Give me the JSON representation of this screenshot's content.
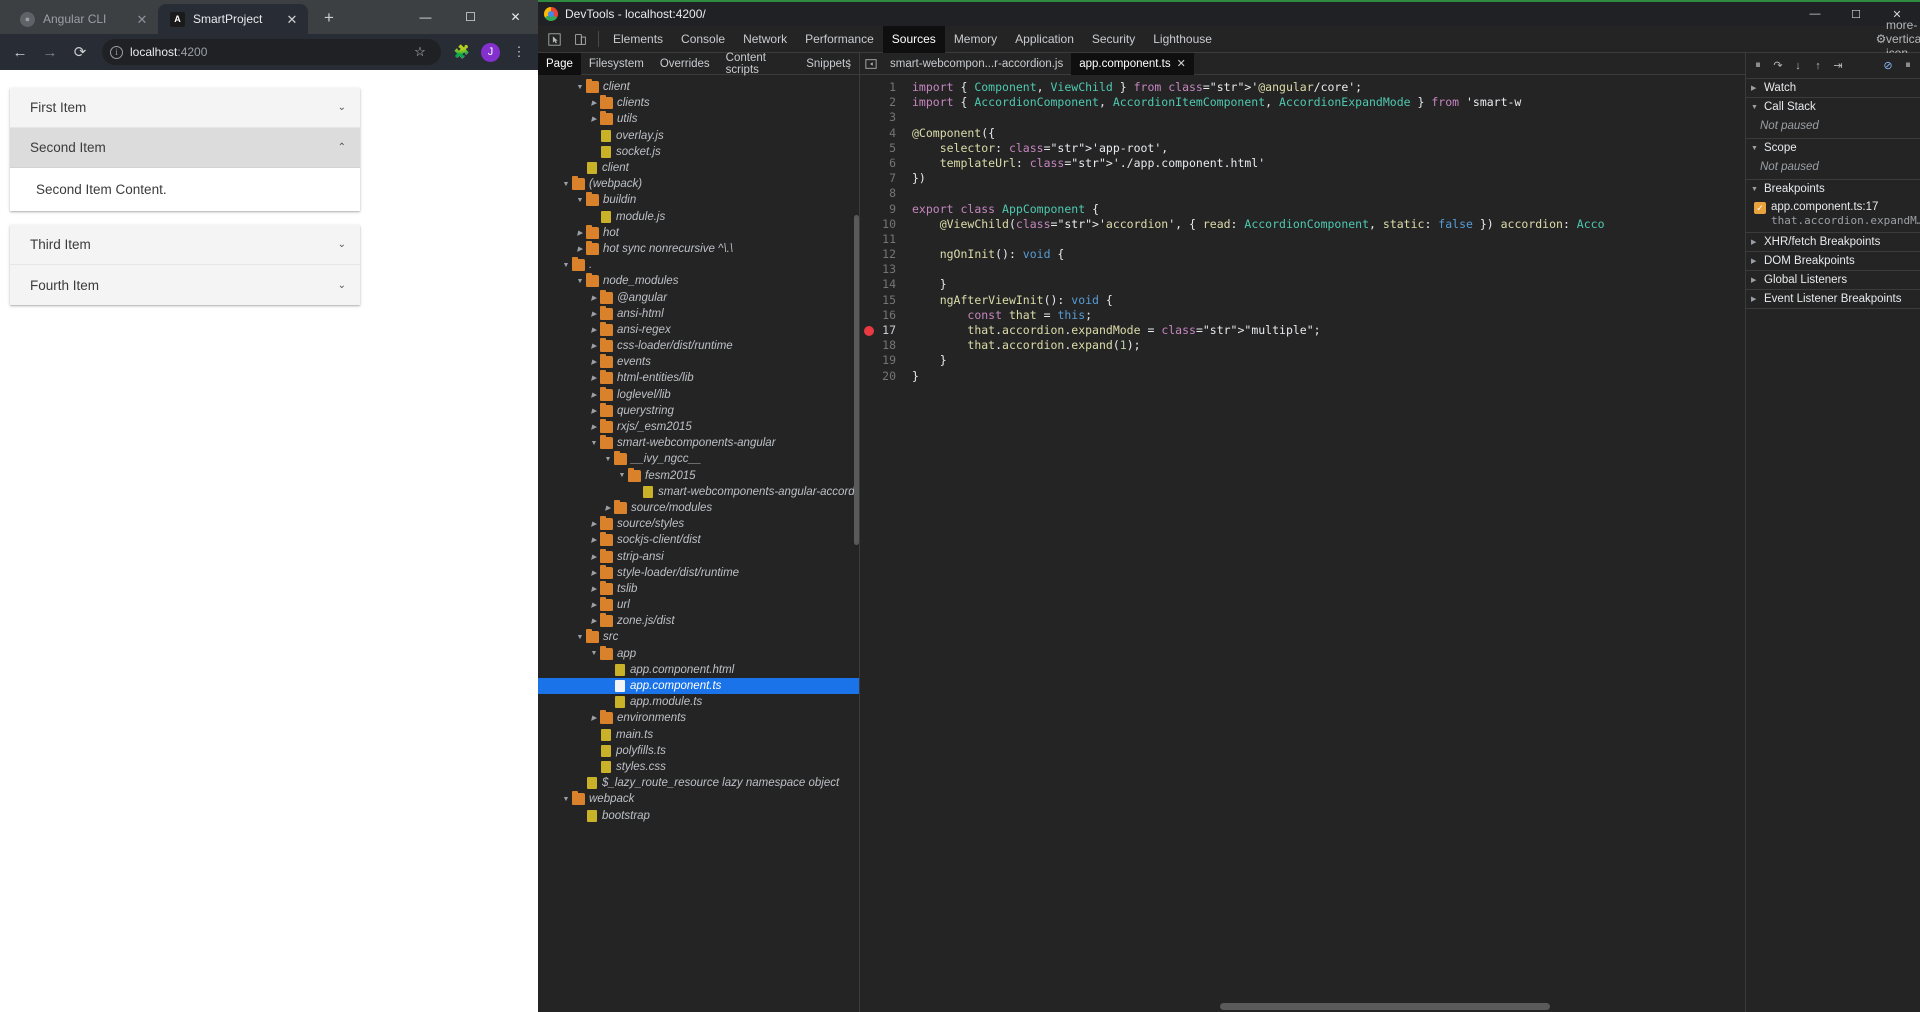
{
  "browser": {
    "tabs": [
      {
        "title": "Angular CLI",
        "favicon": "angular-grey-icon",
        "active": false,
        "close": "✕"
      },
      {
        "title": "SmartProject",
        "favicon": "angular-icon",
        "active": true,
        "close": "✕"
      }
    ],
    "new_tab_label": "+",
    "window_controls": {
      "minimize": "—",
      "maximize": "☐",
      "close": "✕"
    },
    "toolbar": {
      "back": "←",
      "forward": "→",
      "reload": "⟳",
      "url_host": "localhost",
      "url_port": ":4200",
      "star": "☆",
      "extensions": "🧩",
      "avatar_letter": "J",
      "menu": "⋮"
    }
  },
  "accordion": {
    "items": [
      {
        "label": "First Item",
        "expanded": false,
        "selected": false,
        "chevron": "⌄",
        "content": ""
      },
      {
        "label": "Second Item",
        "expanded": true,
        "selected": true,
        "chevron": "⌃",
        "content": "Second Item Content."
      },
      {
        "label": "Third Item",
        "expanded": false,
        "selected": false,
        "chevron": "⌄",
        "content": ""
      },
      {
        "label": "Fourth Item",
        "expanded": false,
        "selected": false,
        "chevron": "⌄",
        "content": ""
      }
    ]
  },
  "devtools": {
    "window_title": "DevTools - localhost:4200/",
    "window_controls": {
      "minimize": "—",
      "maximize": "☐",
      "close": "✕"
    },
    "main_tabs": [
      {
        "label": "Elements",
        "active": false
      },
      {
        "label": "Console",
        "active": false
      },
      {
        "label": "Network",
        "active": false
      },
      {
        "label": "Performance",
        "active": false
      },
      {
        "label": "Sources",
        "active": true
      },
      {
        "label": "Memory",
        "active": false
      },
      {
        "label": "Application",
        "active": false
      },
      {
        "label": "Security",
        "active": false
      },
      {
        "label": "Lighthouse",
        "active": false
      }
    ],
    "inspect_icon": "cursor-inspect-icon",
    "device_icon": "device-toolbar-icon",
    "settings_icon": "gear-icon",
    "more_icon": "more-vertical-icon",
    "navigator": {
      "tabs": [
        {
          "label": "Page",
          "active": true
        },
        {
          "label": "Filesystem",
          "active": false
        },
        {
          "label": "Overrides",
          "active": false
        },
        {
          "label": "Content scripts",
          "active": false
        },
        {
          "label": "Snippets",
          "active": false
        }
      ],
      "more": "⋮",
      "tree": [
        {
          "label": "client",
          "depth": 2,
          "type": "folder",
          "twisty": "▼"
        },
        {
          "label": "clients",
          "depth": 3,
          "type": "folder",
          "twisty": "▶"
        },
        {
          "label": "utils",
          "depth": 3,
          "type": "folder",
          "twisty": "▶"
        },
        {
          "label": "overlay.js",
          "depth": 3,
          "type": "file",
          "twisty": ""
        },
        {
          "label": "socket.js",
          "depth": 3,
          "type": "file",
          "twisty": ""
        },
        {
          "label": "client",
          "depth": 2,
          "type": "file",
          "twisty": ""
        },
        {
          "label": "(webpack)",
          "depth": 1,
          "type": "folder",
          "twisty": "▼"
        },
        {
          "label": "buildin",
          "depth": 2,
          "type": "folder",
          "twisty": "▼"
        },
        {
          "label": "module.js",
          "depth": 3,
          "type": "file",
          "twisty": ""
        },
        {
          "label": "hot",
          "depth": 2,
          "type": "folder",
          "twisty": "▶"
        },
        {
          "label": "hot sync nonrecursive ^\\.\\",
          "depth": 2,
          "type": "folder",
          "twisty": "▶"
        },
        {
          "label": ".",
          "depth": 1,
          "type": "folder",
          "twisty": "▼"
        },
        {
          "label": "node_modules",
          "depth": 2,
          "type": "folder",
          "twisty": "▼"
        },
        {
          "label": "@angular",
          "depth": 3,
          "type": "folder",
          "twisty": "▶"
        },
        {
          "label": "ansi-html",
          "depth": 3,
          "type": "folder",
          "twisty": "▶"
        },
        {
          "label": "ansi-regex",
          "depth": 3,
          "type": "folder",
          "twisty": "▶"
        },
        {
          "label": "css-loader/dist/runtime",
          "depth": 3,
          "type": "folder",
          "twisty": "▶"
        },
        {
          "label": "events",
          "depth": 3,
          "type": "folder",
          "twisty": "▶"
        },
        {
          "label": "html-entities/lib",
          "depth": 3,
          "type": "folder",
          "twisty": "▶"
        },
        {
          "label": "loglevel/lib",
          "depth": 3,
          "type": "folder",
          "twisty": "▶"
        },
        {
          "label": "querystring",
          "depth": 3,
          "type": "folder",
          "twisty": "▶"
        },
        {
          "label": "rxjs/_esm2015",
          "depth": 3,
          "type": "folder",
          "twisty": "▶"
        },
        {
          "label": "smart-webcomponents-angular",
          "depth": 3,
          "type": "folder",
          "twisty": "▼"
        },
        {
          "label": "__ivy_ngcc__",
          "depth": 4,
          "type": "folder",
          "twisty": "▼"
        },
        {
          "label": "fesm2015",
          "depth": 5,
          "type": "folder",
          "twisty": "▼"
        },
        {
          "label": "smart-webcomponents-angular-accordion.js",
          "depth": 6,
          "type": "file",
          "twisty": ""
        },
        {
          "label": "source/modules",
          "depth": 4,
          "type": "folder",
          "twisty": "▶"
        },
        {
          "label": "source/styles",
          "depth": 3,
          "type": "folder",
          "twisty": "▶"
        },
        {
          "label": "sockjs-client/dist",
          "depth": 3,
          "type": "folder",
          "twisty": "▶"
        },
        {
          "label": "strip-ansi",
          "depth": 3,
          "type": "folder",
          "twisty": "▶"
        },
        {
          "label": "style-loader/dist/runtime",
          "depth": 3,
          "type": "folder",
          "twisty": "▶"
        },
        {
          "label": "tslib",
          "depth": 3,
          "type": "folder",
          "twisty": "▶"
        },
        {
          "label": "url",
          "depth": 3,
          "type": "folder",
          "twisty": "▶"
        },
        {
          "label": "zone.js/dist",
          "depth": 3,
          "type": "folder",
          "twisty": "▶"
        },
        {
          "label": "src",
          "depth": 2,
          "type": "folder",
          "twisty": "▼"
        },
        {
          "label": "app",
          "depth": 3,
          "type": "folder",
          "twisty": "▼"
        },
        {
          "label": "app.component.html",
          "depth": 4,
          "type": "file",
          "twisty": ""
        },
        {
          "label": "app.component.ts",
          "depth": 4,
          "type": "file",
          "twisty": "",
          "selected": true
        },
        {
          "label": "app.module.ts",
          "depth": 4,
          "type": "file",
          "twisty": ""
        },
        {
          "label": "environments",
          "depth": 3,
          "type": "folder",
          "twisty": "▶"
        },
        {
          "label": "main.ts",
          "depth": 3,
          "type": "file",
          "twisty": ""
        },
        {
          "label": "polyfills.ts",
          "depth": 3,
          "type": "file",
          "twisty": ""
        },
        {
          "label": "styles.css",
          "depth": 3,
          "type": "file",
          "twisty": ""
        },
        {
          "label": "$_lazy_route_resource lazy namespace object",
          "depth": 2,
          "type": "file",
          "twisty": ""
        },
        {
          "label": "webpack",
          "depth": 1,
          "type": "folder",
          "twisty": "▼"
        },
        {
          "label": "bootstrap",
          "depth": 2,
          "type": "file",
          "twisty": ""
        }
      ]
    },
    "editor": {
      "tabs": [
        {
          "label": "smart-webcompon...r-accordion.js",
          "active": false,
          "close": ""
        },
        {
          "label": "app.component.ts",
          "active": true,
          "close": "✕"
        }
      ],
      "breakpoint_line": 17,
      "lines": [
        {
          "n": 1,
          "text": "import { Component, ViewChild } from '@angular/core';"
        },
        {
          "n": 2,
          "text": "import { AccordionComponent, AccordionItemComponent, AccordionExpandMode } from 'smart-w"
        },
        {
          "n": 3,
          "text": ""
        },
        {
          "n": 4,
          "text": "@Component({"
        },
        {
          "n": 5,
          "text": "    selector: 'app-root',"
        },
        {
          "n": 6,
          "text": "    templateUrl: './app.component.html'"
        },
        {
          "n": 7,
          "text": "})"
        },
        {
          "n": 8,
          "text": ""
        },
        {
          "n": 9,
          "text": "export class AppComponent {"
        },
        {
          "n": 10,
          "text": "    @ViewChild('accordion', { read: AccordionComponent, static: false }) accordion: Acco"
        },
        {
          "n": 11,
          "text": ""
        },
        {
          "n": 12,
          "text": "    ngOnInit(): void {"
        },
        {
          "n": 13,
          "text": ""
        },
        {
          "n": 14,
          "text": "    }"
        },
        {
          "n": 15,
          "text": "    ngAfterViewInit(): void {"
        },
        {
          "n": 16,
          "text": "        const that = this;"
        },
        {
          "n": 17,
          "text": "        that.accordion.expandMode = \"multiple\";"
        },
        {
          "n": 18,
          "text": "        that.accordion.expand(1);"
        },
        {
          "n": 19,
          "text": "    }"
        },
        {
          "n": 20,
          "text": "}"
        }
      ]
    },
    "debugger": {
      "toolbar": {
        "pause": "⏸",
        "step_over": "↷",
        "step_into": "↓",
        "step_out": "↑",
        "step": "⇥",
        "deactivate_breakpoints": "⊘",
        "pause_on_exceptions": "⏸"
      },
      "sections": [
        {
          "title": "Watch",
          "twisty": "▶",
          "body": ""
        },
        {
          "title": "Call Stack",
          "twisty": "▼",
          "body": "Not paused"
        },
        {
          "title": "Scope",
          "twisty": "▼",
          "body": "Not paused"
        },
        {
          "title": "Breakpoints",
          "twisty": "▼",
          "body": ""
        },
        {
          "title": "XHR/fetch Breakpoints",
          "twisty": "▶",
          "body": ""
        },
        {
          "title": "DOM Breakpoints",
          "twisty": "▶",
          "body": ""
        },
        {
          "title": "Global Listeners",
          "twisty": "▶",
          "body": ""
        },
        {
          "title": "Event Listener Breakpoints",
          "twisty": "▶",
          "body": ""
        }
      ],
      "breakpoint": {
        "checked": "✓",
        "location": "app.component.ts:17",
        "snippet": "that.accordion.expandMode..."
      }
    }
  },
  "colors": {
    "accent": "#1a73e8",
    "breakpoint": "#eb3941",
    "folder": "#d9822b",
    "file": "#c9b227",
    "devtools_bg": "#242424"
  }
}
